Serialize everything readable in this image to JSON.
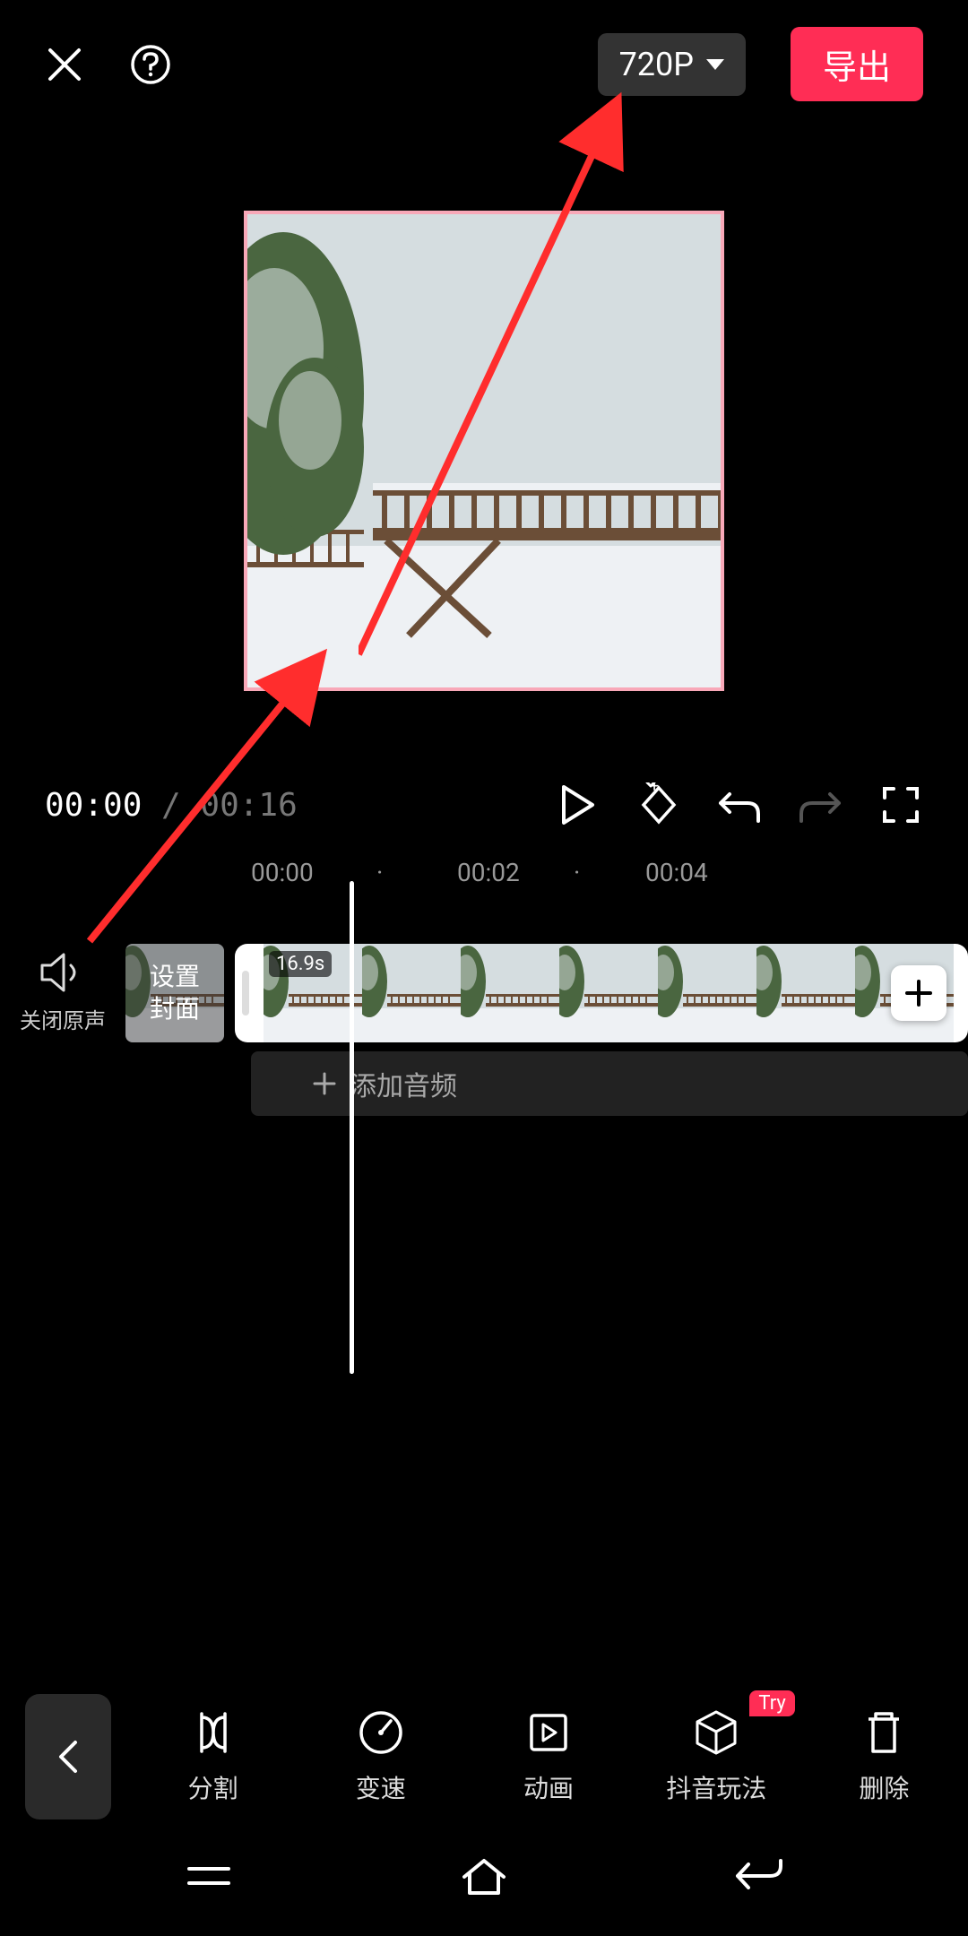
{
  "header": {
    "resolution": "720P",
    "export_label": "导出"
  },
  "playback": {
    "current_time": "00:00",
    "total_time": "00:16"
  },
  "ruler": {
    "marks": [
      "00:00",
      "·",
      "00:02",
      "·",
      "00:04"
    ]
  },
  "timeline": {
    "mute_label": "关闭原声",
    "cover_label_line1": "设置",
    "cover_label_line2": "封面",
    "clip_duration": "16.9s",
    "add_audio_label": "添加音频"
  },
  "tools": {
    "items": [
      {
        "label": "分割"
      },
      {
        "label": "变速"
      },
      {
        "label": "动画"
      },
      {
        "label": "抖音玩法",
        "badge": "Try"
      },
      {
        "label": "删除"
      }
    ]
  },
  "annotation": {
    "arrow_color": "#ff2d2d"
  }
}
